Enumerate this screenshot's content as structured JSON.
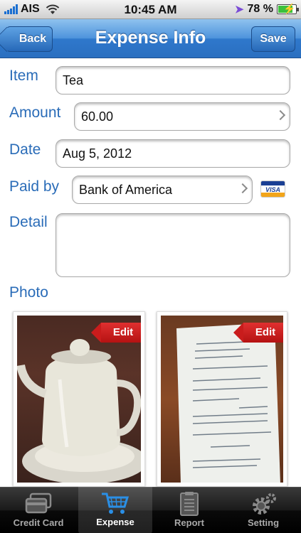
{
  "status": {
    "carrier": "AIS",
    "time": "10:45 AM",
    "battery": "78 %"
  },
  "nav": {
    "title": "Expense Info",
    "back_label": "Back",
    "save_label": "Save"
  },
  "form": {
    "item_label": "Item",
    "item_value": "Tea",
    "amount_label": "Amount",
    "amount_value": "60.00",
    "date_label": "Date",
    "date_value": "Aug 5, 2012",
    "paidby_label": "Paid by",
    "paidby_value": "Bank of America",
    "card_text": "VISA",
    "detail_label": "Detail",
    "detail_value": "",
    "photo_label": "Photo"
  },
  "photos": [
    {
      "edit_label": "Edit"
    },
    {
      "edit_label": "Edit"
    }
  ],
  "tabs": [
    {
      "label": "Credit Card",
      "icon": "credit-card-icon"
    },
    {
      "label": "Expense",
      "icon": "shopping-cart-icon"
    },
    {
      "label": "Report",
      "icon": "report-icon"
    },
    {
      "label": "Setting",
      "icon": "gear-icon"
    }
  ],
  "colors": {
    "nav_blue": "#2f78cc",
    "label_blue": "#2a6cb8",
    "edit_red": "#c91c1c",
    "tabbar": "#000000"
  }
}
